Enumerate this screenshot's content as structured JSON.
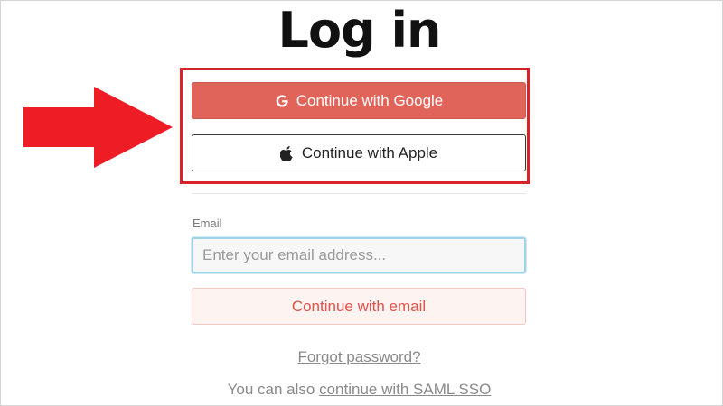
{
  "title": "Log in",
  "auth_buttons": {
    "google_label": "Continue with Google",
    "google_icon": "google-g-icon",
    "apple_label": "Continue with Apple",
    "apple_icon": "apple-logo-icon"
  },
  "email_form": {
    "label": "Email",
    "value": "",
    "placeholder": "Enter your email address...",
    "submit_label": "Continue with email"
  },
  "links": {
    "forgot_password": "Forgot password?",
    "saml_prefix": "You can also ",
    "saml_link": "continue with SAML SSO"
  },
  "annotation": {
    "arrow_icon": "right-arrow-icon",
    "highlight_color": "#d8232a",
    "arrow_color": "#ee1c25"
  },
  "colors": {
    "google_button_bg": "#e0645a",
    "email_button_bg": "#fdf3f1",
    "email_button_text": "#e0524a",
    "input_focus_border": "#9fd3e6"
  }
}
